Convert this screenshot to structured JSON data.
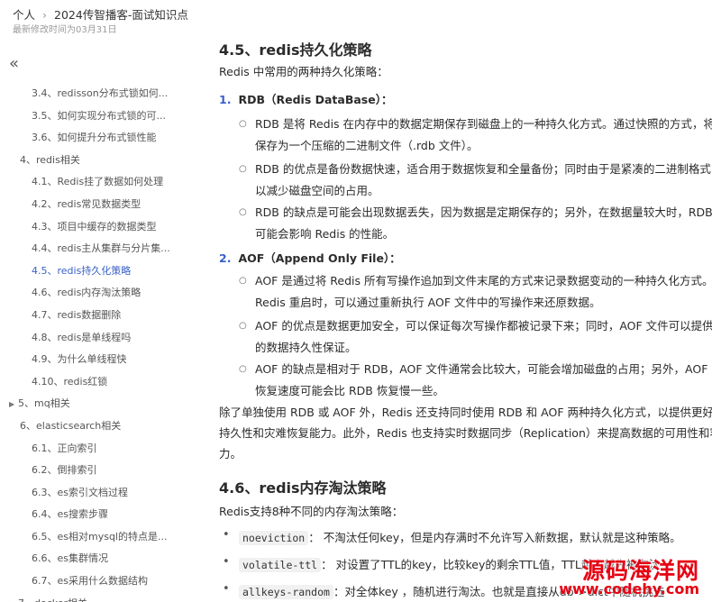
{
  "header": {
    "breadcrumb_root": "个人",
    "breadcrumb_sep": "›",
    "breadcrumb_doc": "2024传智播客-面试知识点",
    "last_modified": "最新修改时间为03月31日"
  },
  "sidebar": {
    "collapse_glyph": "«",
    "items": [
      {
        "label": "3.4、redisson分布式锁如何...",
        "level": 2
      },
      {
        "label": "3.5、如何实现分布式锁的可...",
        "level": 2
      },
      {
        "label": "3.6、如何提升分布式锁性能",
        "level": 2
      },
      {
        "label": "4、redis相关",
        "level": 1
      },
      {
        "label": "4.1、Redis挂了数据如何处理",
        "level": 2
      },
      {
        "label": "4.2、redis常见数据类型",
        "level": 2
      },
      {
        "label": "4.3、项目中缓存的数据类型",
        "level": 2
      },
      {
        "label": "4.4、redis主从集群与分片集...",
        "level": 2
      },
      {
        "label": "4.5、redis持久化策略",
        "level": 2,
        "active": true
      },
      {
        "label": "4.6、redis内存淘汰策略",
        "level": 2
      },
      {
        "label": "4.7、redis数据删除",
        "level": 2
      },
      {
        "label": "4.8、redis是单线程吗",
        "level": 2
      },
      {
        "label": "4.9、为什么单线程快",
        "level": 2
      },
      {
        "label": "4.10、redis红锁",
        "level": 2
      },
      {
        "label": "5、mq相关",
        "level": 1,
        "collapsed": true
      },
      {
        "label": "6、elasticsearch相关",
        "level": 1
      },
      {
        "label": "6.1、正向索引",
        "level": 2
      },
      {
        "label": "6.2、倒排索引",
        "level": 2
      },
      {
        "label": "6.3、es索引文档过程",
        "level": 2
      },
      {
        "label": "6.4、es搜索步骤",
        "level": 2
      },
      {
        "label": "6.5、es相对mysql的特点是...",
        "level": 2
      },
      {
        "label": "6.6、es集群情况",
        "level": 2
      },
      {
        "label": "6.7、es采用什么数据结构",
        "level": 2
      },
      {
        "label": "7、docker相关",
        "level": 1,
        "collapsed": true
      }
    ]
  },
  "content": {
    "h45": "4.5、redis持久化策略",
    "intro": "Redis 中常用的两种持久化策略：",
    "rdb_num": "1.",
    "rdb_title": "RDB（Redis DataBase）：",
    "rdb_b1_l1": "RDB 是将 Redis 在内存中的数据定期保存到磁盘上的一种持久化方式。通过快照的方式，将数据",
    "rdb_b1_l2": "保存为一个压缩的二进制文件（.rdb 文件）。",
    "rdb_b2_l1": "RDB 的优点是备份数据快速，适合用于数据恢复和全量备份；同时由于是紧凑的二进制格式，可",
    "rdb_b2_l2": "以减少磁盘空间的占用。",
    "rdb_b3_l1": "RDB 的缺点是可能会出现数据丢失，因为数据是定期保存的；另外，在数据量较大时，RDB 持久化",
    "rdb_b3_l2": "可能会影响 Redis 的性能。",
    "aof_num": "2.",
    "aof_title": "AOF（Append Only File）：",
    "aof_b1_l1": "AOF 是通过将 Redis 所有写操作追加到文件末尾的方式来记录数据变动的一种持久化方式。在",
    "aof_b1_l2": "Redis 重启时，可以通过重新执行 AOF 文件中的写操作来还原数据。",
    "aof_b2_l1": "AOF 的优点是数据更加安全，可以保证每次写操作都被记录下来；同时，AOF 文件可以提供更好",
    "aof_b2_l2": "的数据持久性保证。",
    "aof_b3_l1": "AOF 的缺点是相对于 RDB，AOF 文件通常会比较大，可能会增加磁盘的占用；另外，AOF 文件的",
    "aof_b3_l2": "恢复速度可能会比 RDB 恢复慢一些。",
    "summary_l1": "除了单独使用 RDB 或 AOF 外，Redis 还支持同时使用 RDB 和 AOF 两种持久化方式，以提供更好的数据",
    "summary_l2": "持久性和灾难恢复能力。此外，Redis 也支持实时数据同步（Replication）来提高数据的可用性和容错能",
    "summary_l3": "力。",
    "h46": "4.6、redis内存淘汰策略",
    "evict_intro": "Redis支持8种不同的内存淘汰策略：",
    "evict": [
      {
        "code": "noeviction",
        "text": "： 不淘汰任何key，但是内存满时不允许写入新数据，默认就是这种策略。"
      },
      {
        "code": "volatile-ttl",
        "text": "： 对设置了TTL的key，比较key的剩余TTL值，TTL越小越先被淘汰"
      },
      {
        "code": "allkeys-random",
        "text": "：对全体key ，随机进行淘汰。也就是直接从db->dict中随机挑选"
      }
    ]
  },
  "watermark": {
    "title": "源码海洋网",
    "url": "www.codehy.com"
  }
}
